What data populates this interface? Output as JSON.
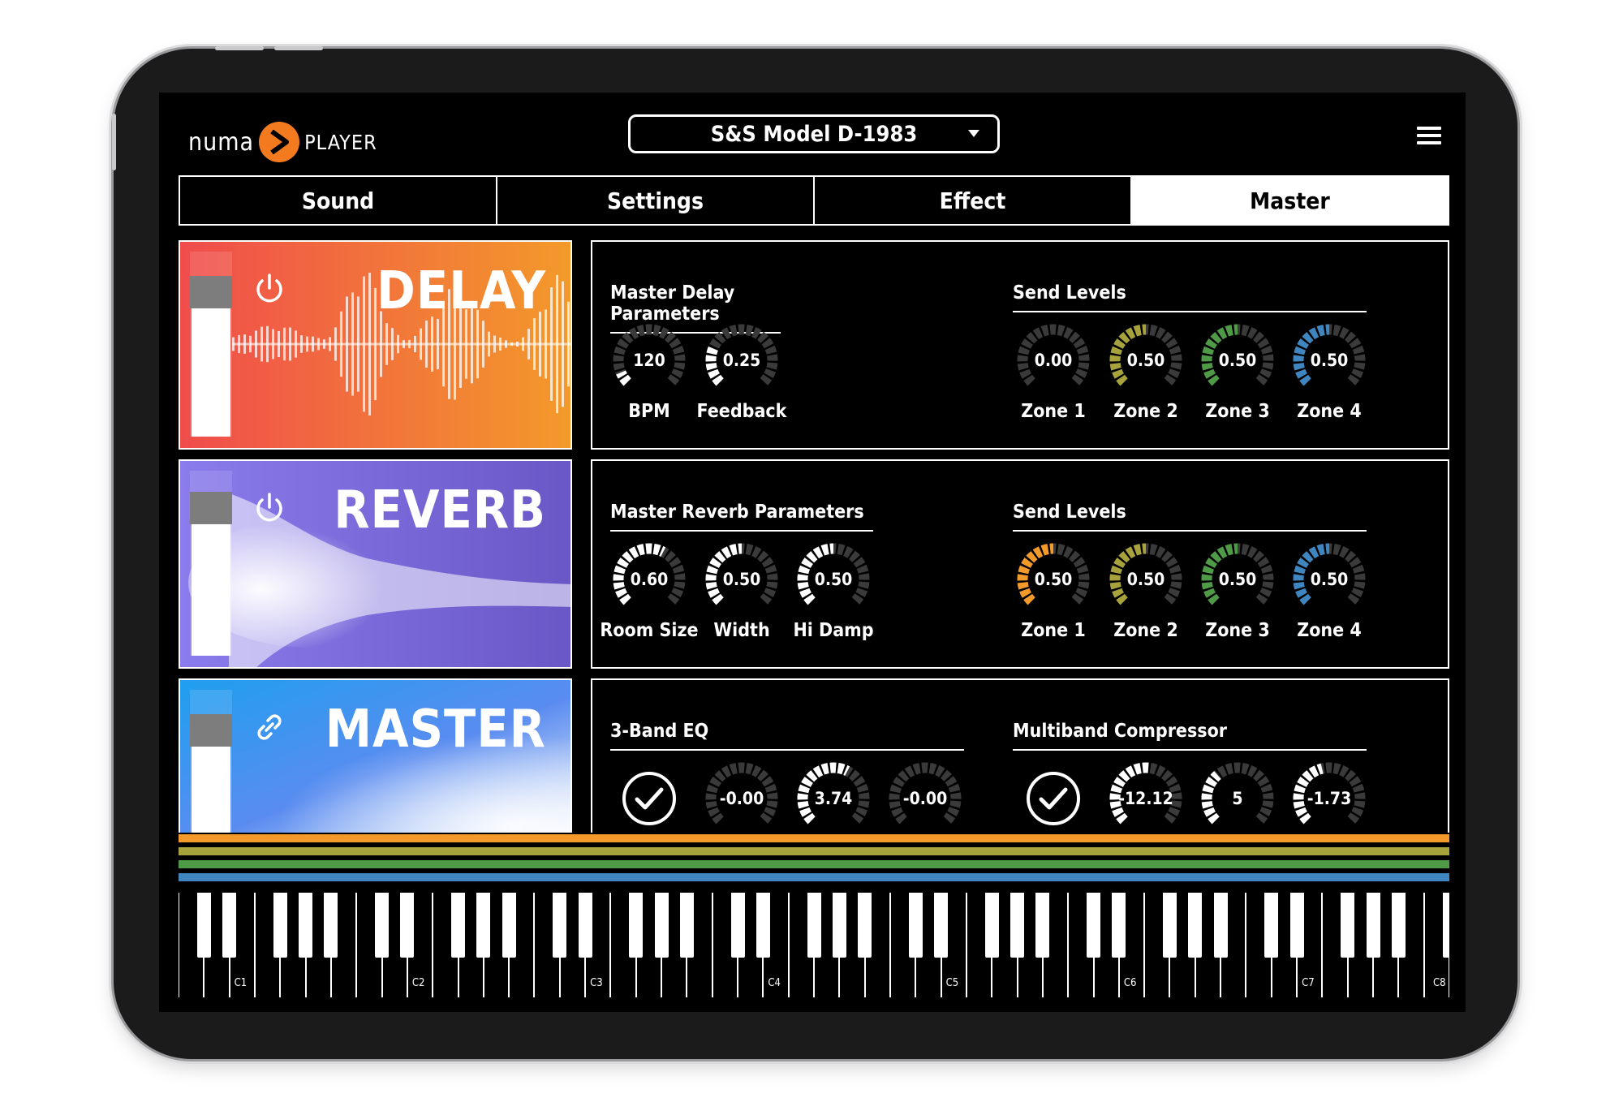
{
  "header": {
    "logo_left": "numa",
    "logo_right": "PLAYER",
    "preset_name": "S&S Model D-1983",
    "menu_icon": "hamburger-menu-icon"
  },
  "tabs": [
    {
      "label": "Sound",
      "active": false
    },
    {
      "label": "Settings",
      "active": false
    },
    {
      "label": "Effect",
      "active": false
    },
    {
      "label": "Master",
      "active": true
    }
  ],
  "effects": {
    "delay": {
      "title": "DELAY",
      "icon": "power-icon",
      "gradient": [
        "#f04c4c",
        "#f39a2a"
      ],
      "level": 0.78
    },
    "reverb": {
      "title": "REVERB",
      "icon": "power-icon",
      "gradient": [
        "#7f6ee0",
        "#6e5bc9"
      ],
      "level": 0.8
    },
    "master": {
      "title": "MASTER",
      "icon": "link-icon",
      "gradient": [
        "#2aa7ef",
        "#dbe8fb"
      ],
      "level": 0.78
    }
  },
  "delay_panel": {
    "params_title": "Master Delay Parameters",
    "params": [
      {
        "label": "BPM",
        "value": "120",
        "level": 0.08
      },
      {
        "label": "Feedback",
        "value": "0.25",
        "level": 0.25
      }
    ],
    "send_title": "Send Levels",
    "sends": [
      {
        "label": "Zone 1",
        "value": "0.00",
        "level": 0.0,
        "color": "#ffffff"
      },
      {
        "label": "Zone 2",
        "value": "0.50",
        "level": 0.5,
        "color": "#a8a23c"
      },
      {
        "label": "Zone 3",
        "value": "0.50",
        "level": 0.5,
        "color": "#4f9a47"
      },
      {
        "label": "Zone 4",
        "value": "0.50",
        "level": 0.5,
        "color": "#3f86c1"
      }
    ]
  },
  "reverb_panel": {
    "params_title": "Master Reverb Parameters",
    "params": [
      {
        "label": "Room Size",
        "value": "0.60",
        "level": 0.6
      },
      {
        "label": "Width",
        "value": "0.50",
        "level": 0.5
      },
      {
        "label": "Hi Damp",
        "value": "0.50",
        "level": 0.5
      }
    ],
    "send_title": "Send Levels",
    "sends": [
      {
        "label": "Zone 1",
        "value": "0.50",
        "level": 0.5,
        "color": "#f39a2a"
      },
      {
        "label": "Zone 2",
        "value": "0.50",
        "level": 0.5,
        "color": "#a8a23c"
      },
      {
        "label": "Zone 3",
        "value": "0.50",
        "level": 0.5,
        "color": "#4f9a47"
      },
      {
        "label": "Zone 4",
        "value": "0.50",
        "level": 0.5,
        "color": "#3f86c1"
      }
    ]
  },
  "master_panel": {
    "eq_title": "3-Band EQ",
    "eq_enabled": true,
    "eq_knobs": [
      {
        "value": "-0.00",
        "level": 0.0
      },
      {
        "value": "3.74",
        "level": 0.6
      },
      {
        "value": "-0.00",
        "level": 0.0
      }
    ],
    "comp_title": "Multiband Compressor",
    "comp_enabled": true,
    "comp_knobs": [
      {
        "value": "-12.12",
        "level": 0.52
      },
      {
        "value": "5",
        "level": 0.35
      },
      {
        "value": "-1.73",
        "level": 0.45
      }
    ]
  },
  "zone_colors": [
    "#f39a2a",
    "#a8a23c",
    "#4f9a47",
    "#3f86c1"
  ],
  "keyboard": {
    "octave_labels": [
      "C1",
      "C2",
      "C3",
      "C4",
      "C5",
      "C6",
      "C7",
      "C8"
    ]
  }
}
